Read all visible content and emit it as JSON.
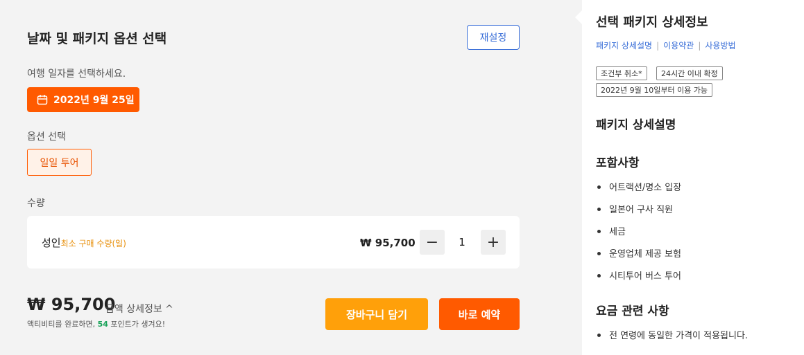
{
  "options_panel": {
    "title": "날짜 및 패키지 옵션 선택",
    "reset_label": "재설정",
    "date_prompt": "여행 일자를 선택하세요.",
    "selected_date": "2022년 9월 25일",
    "option_label": "옵션 선택",
    "selected_option": "일일 투어",
    "quantity_label": "수량",
    "quantity_item": {
      "name": "성인",
      "min_note": "최소 구매 수량(일)",
      "price": "₩ 95,700",
      "minus_label": "−",
      "quantity": "1",
      "plus_label": "+"
    },
    "total_price": "₩ 95,700",
    "detail_label": "금액 상세정보 ^",
    "points_prefix": "액티비티를 완료하면, ",
    "points_value": "54",
    "points_suffix": " 포인트가 생겨요!",
    "cart_button": "장바구니 담기",
    "buy_button": "바로 예약"
  },
  "detail_panel": {
    "title": "선택 패키지 상세정보",
    "links": [
      "패키지 상세설명",
      "이용약관",
      "사용방법"
    ],
    "link_separator": "|",
    "tags": [
      "조건부 취소*",
      "24시간 이내 확정",
      "2022년 9월 10일부터 이용 가능"
    ],
    "description_heading": "패키지 상세설명",
    "includes_heading": "포함사항",
    "includes": [
      "어트랙션/명소 입장",
      "일본어 구사 직원",
      "세금",
      "운영업체 제공 보험",
      "시티투어 버스 투어"
    ],
    "fee_heading": "요금 관련 사항",
    "fee_notes": [
      "전 연령에 동일한 가격이 적용됩니다."
    ]
  },
  "colors": {
    "accent_orange": "#ff5a00",
    "cart_yellow": "#ffa00a",
    "link_blue": "#3a6fd8",
    "points_green": "#1aa35a"
  },
  "icons": [
    "calendar-icon",
    "minus-icon",
    "plus-icon",
    "chevron-up-icon"
  ]
}
